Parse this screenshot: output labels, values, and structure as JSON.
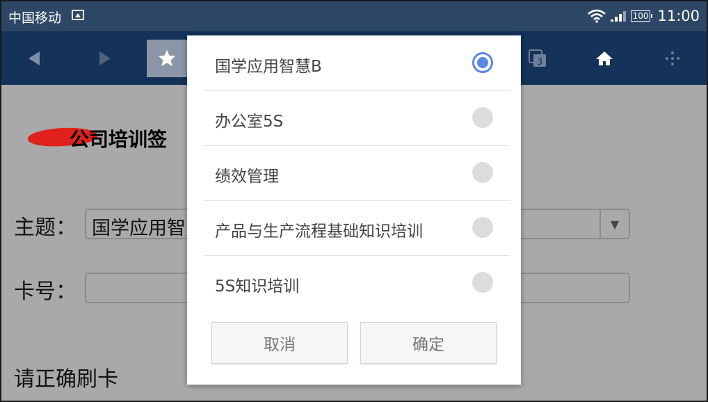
{
  "status_bar": {
    "carrier": "中国移动",
    "battery": "100",
    "time": "11:00"
  },
  "toolbar": {
    "icons": [
      "back-icon",
      "forward-icon",
      "star-icon",
      "tabs-icon",
      "home-icon",
      "menu-icon"
    ],
    "tabs_count": "3"
  },
  "page": {
    "title_visible": "公司培训签",
    "topic_label": "主题：",
    "topic_value_visible": "国学应用智",
    "card_label": "卡号：",
    "hint": "请正确刷卡"
  },
  "dialog": {
    "options": [
      {
        "label": "国学应用智慧B",
        "selected": true
      },
      {
        "label": "办公室5S",
        "selected": false
      },
      {
        "label": "绩效管理",
        "selected": false
      },
      {
        "label": "产品与生产流程基础知识培训",
        "selected": false
      },
      {
        "label": "5S知识培训",
        "selected": false
      }
    ],
    "cancel": "取消",
    "confirm": "确定"
  },
  "colors": {
    "status_bar": "#2d4766",
    "toolbar": "#14325a",
    "radio_selected": "#5b86e8",
    "redaction": "#e0211d"
  }
}
